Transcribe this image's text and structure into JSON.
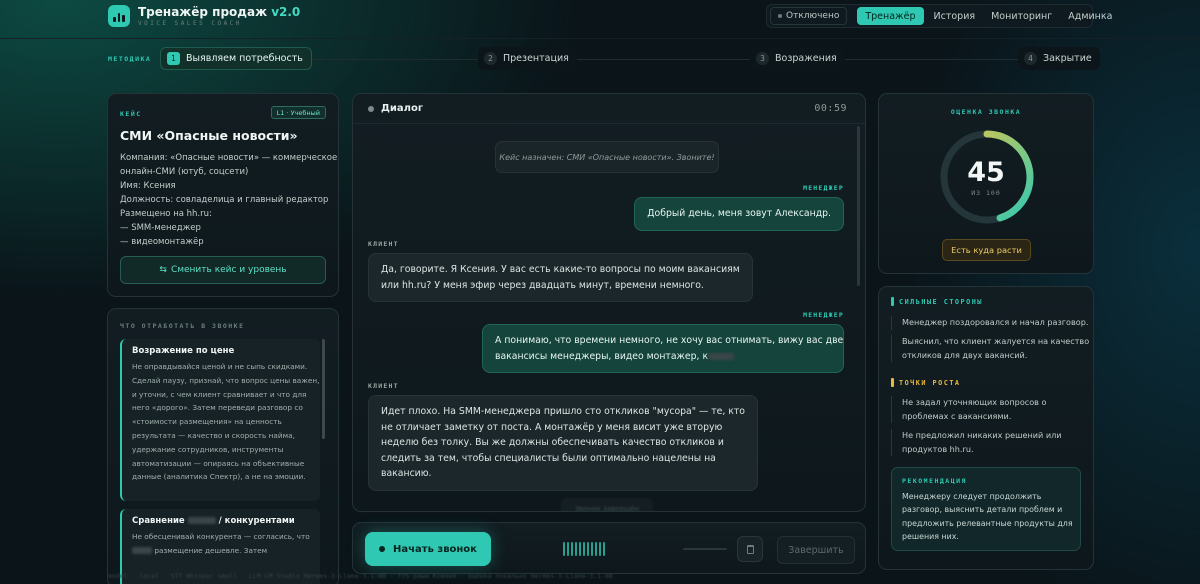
{
  "app": {
    "title": "Тренажёр продаж",
    "version": "v2.0",
    "subtitle": "VOICE SALES COACH",
    "accent": "#2fc9b3"
  },
  "nav": {
    "status": "Отключено",
    "items": [
      "Тренажёр",
      "История",
      "Мониторинг",
      "Админка"
    ],
    "active": "Тренажёр"
  },
  "steps": {
    "label": "МЕТОДИКА",
    "items": [
      {
        "num": "1",
        "label": "Выявляем потребность",
        "active": true
      },
      {
        "num": "2",
        "label": "Презентация",
        "active": false
      },
      {
        "num": "3",
        "label": "Возражения",
        "active": false
      },
      {
        "num": "4",
        "label": "Закрытие",
        "active": false
      }
    ]
  },
  "case": {
    "caption": "КЕЙС",
    "badge": "L1 · Учебный",
    "title": "СМИ «Опасные новости»",
    "lines": [
      "Компания: «Опасные новости» — коммерческое",
      "онлайн-СМИ (ютуб, соцсети)",
      "Имя: Ксения",
      "Должность: совладелица и главный редактор",
      "Размещено на hh.ru:",
      "— SMM-менеджер",
      "— видеомонтажёр"
    ],
    "switch_button": "Сменить кейс и уровень"
  },
  "tips": {
    "caption": "ЧТО ОТРАБОТАТЬ В ЗВОНКЕ",
    "card1": {
      "title": "Возражение по цене",
      "lines": [
        "Не оправдывайся ценой и не сыпь скидками.",
        "Сделай паузу, признай, что вопрос цены важен,",
        "и уточни, с чем клиент сравнивает и что для",
        "него «дорого». Затем переведи разговор со",
        "«стоимости размещения» на ценность",
        "результата — качество и скорость найма,",
        "удержание сотрудников, инструменты",
        "автоматизации — опираясь на объективные",
        "данные (аналитика Спектр), а не на эмоции."
      ]
    },
    "card2": {
      "title_start": "Сравнение",
      "title_end": "/ конкурентами",
      "line1": "Не обесценивай конкурента — согласись, что",
      "line2_end": "размещение дешевле. Затем"
    }
  },
  "dialog": {
    "title": "Диалог",
    "timer": "00:59",
    "system": "Кейс назначен: СМИ «Опасные новости». Звоните!",
    "manager_role": "МЕНЕДЖЕР",
    "client_role": "КЛИЕНТ",
    "messages": [
      {
        "lines": [
          "Добрый день, меня зовут Александр."
        ]
      },
      {
        "lines": [
          "Да, говорите. Я Ксения. У вас есть какие-то вопросы по моим вакансиям",
          "или hh.ru? У меня эфир через двадцать минут, времени немного."
        ]
      },
      {
        "lines": [
          "А понимаю, что времени немного, не хочу вас отнимать, вижу вас две",
          "вакансисы менеджеры, видео монтажер, к"
        ]
      },
      {
        "lines": [
          "Идет плохо. На SMM-менеджера пришло сто откликов \"мусора\" — те, кто",
          "не отличает заметку от поста. А монтажёр у меня висит уже вторую",
          "неделю без толку. Вы же должны обеспечивать качество откликов и",
          "следить за тем, чтобы специалисты были оптимально нацелены на",
          "вакансию."
        ]
      }
    ],
    "hidden_chip": "Звонок завершён"
  },
  "controls": {
    "start": "Начать звонок",
    "finish": "Завершить"
  },
  "score": {
    "caption": "ОЦЕНКА ЗВОНКА",
    "value": 45,
    "max": 100,
    "of_label": "ИЗ 100",
    "badge": "Есть куда расти"
  },
  "analysis": {
    "strengths": {
      "caption": "СИЛЬНЫЕ СТОРОНЫ",
      "color": "#2fc9b3",
      "items": [
        [
          "Менеджер поздоровался и начал разговор."
        ],
        [
          "Выяснил, что клиент жалуется на качество",
          "откликов для двух вакансий."
        ]
      ]
    },
    "growth": {
      "caption": "ТОЧКИ РОСТА",
      "color": "#e6b93f",
      "items": [
        [
          "Не задал уточняющих вопросов о",
          "проблемах с вакансиями."
        ],
        [
          "Не предложил никаких решений или",
          "продуктов hh.ru."
        ]
      ]
    },
    "recommendation": {
      "caption": "РЕКОМЕНДАЦИЯ",
      "lines": [
        "Менеджеру следует продолжить",
        "разговор, выяснить детали проблем и",
        "предложить релевантные продукты для",
        "решения них."
      ]
    }
  },
  "footer": "model · local · STT Whisper small · LLM LM Studio Hermes-3-Llama-3.1-8B · TTS pawa Ксения · оценка локально Hermes-3-Llama-3.1-8B"
}
